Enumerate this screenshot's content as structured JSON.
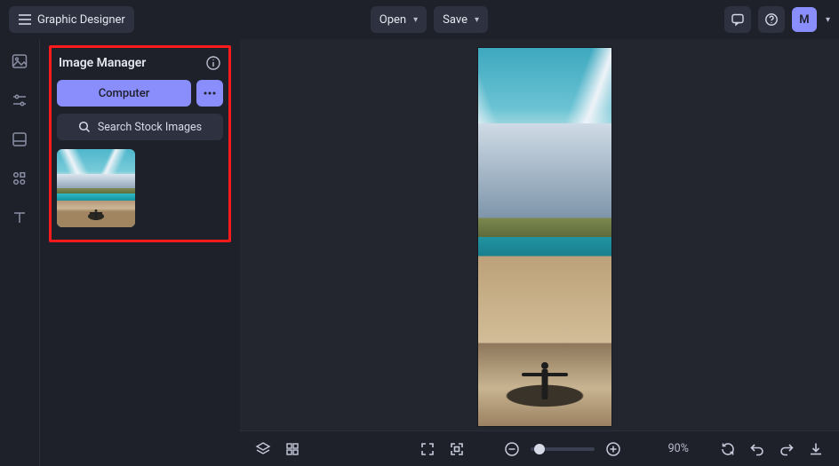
{
  "header": {
    "app_title": "Graphic Designer",
    "open_label": "Open",
    "save_label": "Save",
    "avatar_initial": "M"
  },
  "sidepanel": {
    "title": "Image Manager",
    "computer_label": "Computer",
    "search_label": "Search Stock Images"
  },
  "bottombar": {
    "zoom_label": "90%"
  }
}
